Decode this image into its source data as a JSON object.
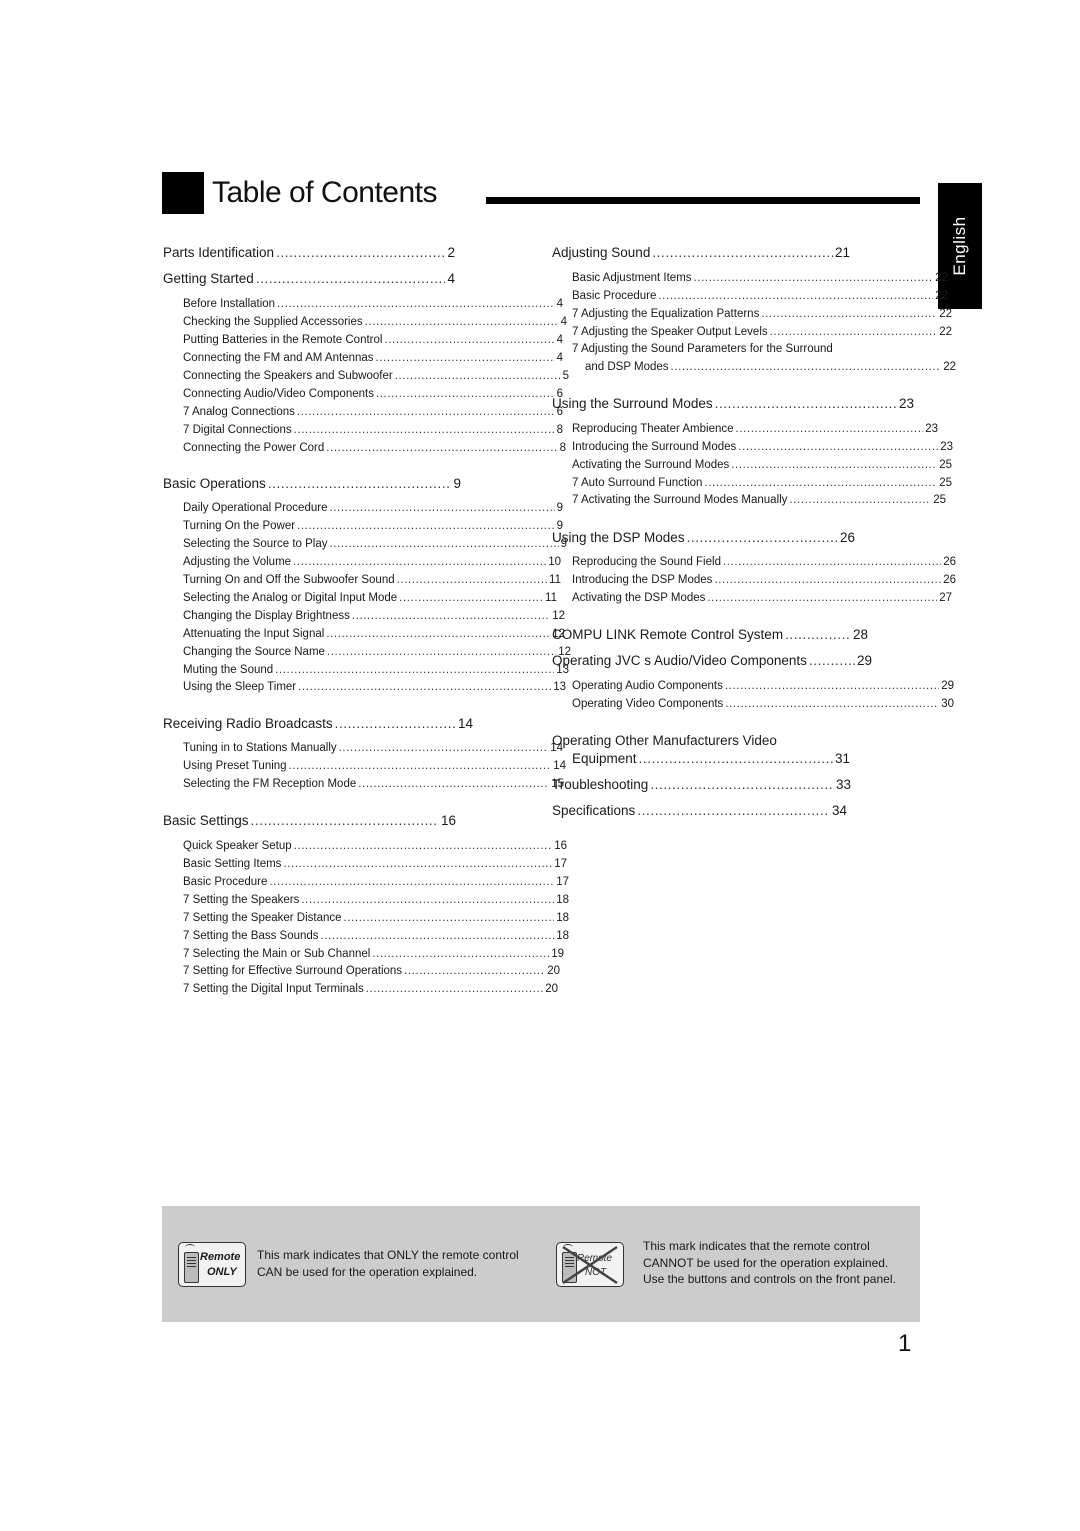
{
  "header": {
    "title": "Table of Contents",
    "language_tab": "English"
  },
  "left_column": [
    {
      "type": "main",
      "label": "Parts Identification",
      "page": "2"
    },
    {
      "type": "main",
      "label": "Getting Started",
      "page": "4"
    },
    {
      "type": "sub",
      "label": "Before Installation",
      "page": "4"
    },
    {
      "type": "sub",
      "label": "Checking the Supplied Accessories",
      "page": "4"
    },
    {
      "type": "sub",
      "label": "Putting Batteries in the Remote Control",
      "page": "4"
    },
    {
      "type": "sub",
      "label": "Connecting the FM and AM Antennas",
      "page": "4"
    },
    {
      "type": "sub",
      "label": "Connecting the Speakers and Subwoofer",
      "page": "5"
    },
    {
      "type": "sub",
      "label": "Connecting Audio/Video Components",
      "page": "6"
    },
    {
      "type": "sub",
      "label": "7 Analog Connections",
      "page": "6"
    },
    {
      "type": "sub",
      "label": "7 Digital Connections",
      "page": "8"
    },
    {
      "type": "sub",
      "label": "Connecting the Power Cord",
      "page": "8"
    },
    {
      "type": "main",
      "label": "Basic Operations",
      "page": "9"
    },
    {
      "type": "sub",
      "label": "Daily Operational Procedure",
      "page": "9"
    },
    {
      "type": "sub",
      "label": "Turning On the Power",
      "page": "9"
    },
    {
      "type": "sub",
      "label": "Selecting the Source to Play",
      "page": "9"
    },
    {
      "type": "sub",
      "label": "Adjusting the Volume",
      "page": "10"
    },
    {
      "type": "sub",
      "label": "Turning On and Off the Subwoofer Sound",
      "page": "11"
    },
    {
      "type": "sub",
      "label": "Selecting the Analog or Digital Input Mode",
      "page": "11"
    },
    {
      "type": "sub",
      "label": "Changing the Display Brightness",
      "page": "12"
    },
    {
      "type": "sub",
      "label": "Attenuating the Input Signal",
      "page": "12"
    },
    {
      "type": "sub",
      "label": "Changing the Source Name",
      "page": "12"
    },
    {
      "type": "sub",
      "label": "Muting the Sound",
      "page": "13"
    },
    {
      "type": "sub",
      "label": "Using the Sleep Timer",
      "page": "13"
    },
    {
      "type": "main",
      "label": "Receiving Radio Broadcasts",
      "page": "14"
    },
    {
      "type": "sub",
      "label": "Tuning in to Stations Manually",
      "page": "14"
    },
    {
      "type": "sub",
      "label": "Using Preset Tuning",
      "page": "14"
    },
    {
      "type": "sub",
      "label": "Selecting the FM Reception Mode",
      "page": "15"
    },
    {
      "type": "main",
      "label": "Basic Settings",
      "page": "16"
    },
    {
      "type": "sub",
      "label": "Quick Speaker Setup",
      "page": "16"
    },
    {
      "type": "sub",
      "label": "Basic Setting Items",
      "page": "17"
    },
    {
      "type": "sub",
      "label": "Basic Procedure",
      "page": "17"
    },
    {
      "type": "sub",
      "label": "7 Setting the Speakers",
      "page": "18"
    },
    {
      "type": "sub",
      "label": "7 Setting the Speaker Distance",
      "page": "18"
    },
    {
      "type": "sub",
      "label": "7 Setting the Bass Sounds",
      "page": "18"
    },
    {
      "type": "sub",
      "label": "7 Selecting the Main or Sub Channel",
      "page": "19"
    },
    {
      "type": "sub",
      "label": "7 Setting for Effective Surround Operations",
      "page": "20"
    },
    {
      "type": "sub",
      "label": "7 Setting the Digital Input Terminals",
      "page": "20"
    }
  ],
  "right_column": [
    {
      "type": "main",
      "label": "Adjusting Sound",
      "page": "21"
    },
    {
      "type": "sub",
      "label": "Basic Adjustment Items",
      "page": "22"
    },
    {
      "type": "sub",
      "label": "Basic Procedure",
      "page": "22"
    },
    {
      "type": "sub",
      "label": "7 Adjusting the Equalization Patterns",
      "page": "22"
    },
    {
      "type": "sub",
      "label": "7 Adjusting the Speaker Output Levels",
      "page": "22"
    },
    {
      "type": "sub-nodots",
      "label": "7 Adjusting the Sound Parameters for the Surround",
      "page": ""
    },
    {
      "type": "sub",
      "label": "and DSP Modes",
      "page": "22"
    },
    {
      "type": "main",
      "label": "Using the Surround Modes",
      "page": "23"
    },
    {
      "type": "sub",
      "label": "Reproducing Theater Ambience",
      "page": "23"
    },
    {
      "type": "sub",
      "label": "Introducing the Surround Modes",
      "page": "23"
    },
    {
      "type": "sub",
      "label": "Activating the Surround Modes",
      "page": "25"
    },
    {
      "type": "sub",
      "label": "7 Auto Surround Function",
      "page": "25"
    },
    {
      "type": "sub",
      "label": "7 Activating the Surround Modes Manually",
      "page": "25"
    },
    {
      "type": "main",
      "label": "Using the DSP Modes",
      "page": "26"
    },
    {
      "type": "sub",
      "label": "Reproducing the Sound Field",
      "page": "26"
    },
    {
      "type": "sub",
      "label": "Introducing the DSP Modes",
      "page": "26"
    },
    {
      "type": "sub",
      "label": "Activating the DSP Modes",
      "page": "27"
    },
    {
      "type": "main",
      "label": "COMPU LINK Remote Control System",
      "page": "28"
    },
    {
      "type": "main",
      "label": "Operating JVC s Audio/Video Components",
      "page": "29"
    },
    {
      "type": "sub",
      "label": "Operating Audio Components",
      "page": "29"
    },
    {
      "type": "sub",
      "label": "Operating Video Components",
      "page": "30"
    },
    {
      "type": "main-nodots",
      "label": "Operating Other Manufacturers  Video",
      "page": ""
    },
    {
      "type": "main",
      "label": "Equipment",
      "page": "31"
    },
    {
      "type": "main",
      "label": "Troubleshooting",
      "page": "33"
    },
    {
      "type": "main",
      "label": "Specifications",
      "page": "34"
    }
  ],
  "legend": {
    "remote_only": {
      "icon_line1": "Remote",
      "icon_line2": "ONLY",
      "text_line1": "This mark indicates that ONLY the remote control",
      "text_line2": "CAN be used for the operation explained."
    },
    "remote_not": {
      "icon_line1": "Remote",
      "icon_line2": "NOT",
      "text_line1": "This mark indicates that the remote control",
      "text_line2": "CANNOT be used for the operation explained.",
      "text_line3": "Use the buttons and controls on the front panel."
    }
  },
  "footer": {
    "page_number": "1"
  }
}
